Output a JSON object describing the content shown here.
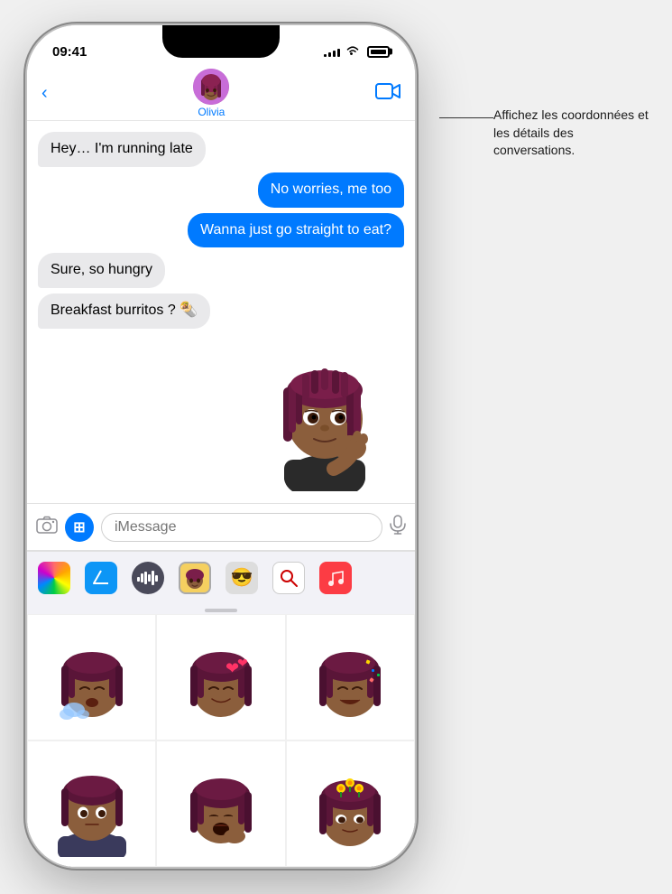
{
  "status": {
    "time": "09:41",
    "signal_bars": [
      3,
      5,
      7,
      9,
      11
    ],
    "battery_level": "full"
  },
  "header": {
    "back_label": "",
    "contact_name": "Olivia",
    "video_call_icon": "video-camera"
  },
  "messages": [
    {
      "id": 1,
      "type": "received",
      "text": "Hey… I'm running late"
    },
    {
      "id": 2,
      "type": "sent",
      "text": "No worries, me too"
    },
    {
      "id": 3,
      "type": "sent",
      "text": "Wanna just go straight to eat?"
    },
    {
      "id": 4,
      "type": "received",
      "text": "Sure, so hungry"
    },
    {
      "id": 5,
      "type": "received",
      "text": "Breakfast burritos ? 🌯"
    }
  ],
  "input": {
    "placeholder": "iMessage",
    "camera_icon": "camera",
    "apps_icon": "A",
    "mic_icon": "mic"
  },
  "app_strip": {
    "icons": [
      {
        "id": "photos",
        "label": "Photos"
      },
      {
        "id": "appstore",
        "label": "App Store"
      },
      {
        "id": "soundboard",
        "label": "Soundboard"
      },
      {
        "id": "memoji",
        "label": "Memoji"
      },
      {
        "id": "stickers",
        "label": "Stickers"
      },
      {
        "id": "search",
        "label": "Search"
      },
      {
        "id": "music",
        "label": "Music"
      }
    ]
  },
  "memoji_grid": [
    {
      "id": 1,
      "label": "memoji-sneeze"
    },
    {
      "id": 2,
      "label": "memoji-love"
    },
    {
      "id": 3,
      "label": "memoji-confetti"
    },
    {
      "id": 4,
      "label": "memoji-coat"
    },
    {
      "id": 5,
      "label": "memoji-yawn"
    },
    {
      "id": 6,
      "label": "memoji-crown"
    }
  ],
  "annotation": {
    "text": "Affichez les coordonnées et les détails des conversations."
  }
}
